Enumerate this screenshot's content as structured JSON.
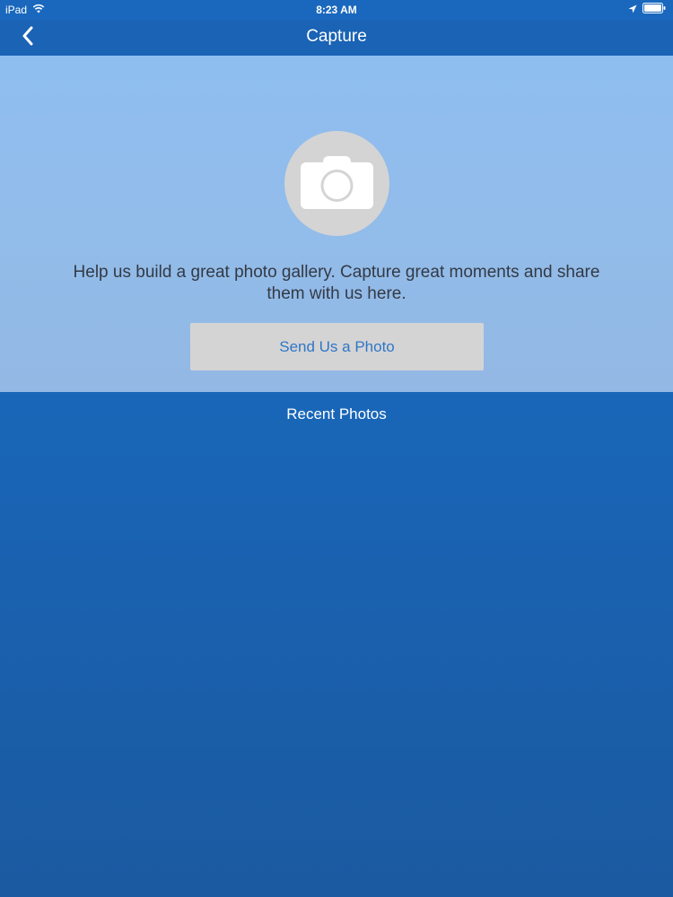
{
  "status_bar": {
    "device": "iPad",
    "time": "8:23 AM"
  },
  "nav": {
    "title": "Capture"
  },
  "hero": {
    "message": "Help us build a great photo gallery. Capture great moments and share them with us here.",
    "button_label": "Send Us a Photo"
  },
  "recent": {
    "label": "Recent Photos"
  },
  "colors": {
    "nav_background": "#1a63b5",
    "hero_background": "#8ebef0",
    "button_background": "#d4d4d4",
    "button_text": "#2f76c9"
  },
  "icons": [
    "wifi-icon",
    "location-arrow-icon",
    "battery-icon",
    "back-chevron-icon",
    "camera-icon"
  ]
}
